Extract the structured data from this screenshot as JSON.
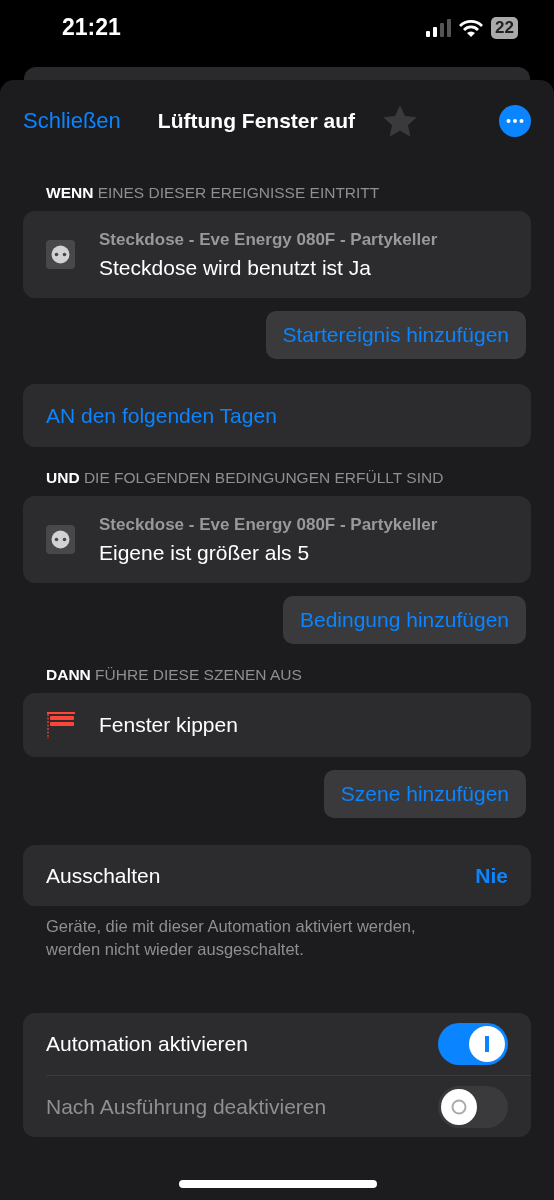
{
  "status_bar": {
    "time": "21:21",
    "battery": "22"
  },
  "header": {
    "close": "Schließen",
    "title": "Lüftung Fenster auf",
    "favorite": false
  },
  "sections": [
    {
      "heading": "**WENN** EINES DIESER EREIGNISSE EINTRITT",
      "items": [
        {
          "kind": "outlet",
          "subtitle": "Steckdose - Eve Energy 080F - Partykeller",
          "label": "Steckdose wird benutzt ist Ja"
        }
      ],
      "add_button": "Startereignis hinzufügen"
    },
    {
      "link_card": "AN den folgenden Tagen"
    },
    {
      "heading": "**UND** DIE FOLGENDEN BEDINGUNGEN ERFÜLLT SIND",
      "items": [
        {
          "kind": "outlet",
          "subtitle": "Steckdose - Eve Energy 080F - Partykeller",
          "label": "Eigene ist größer als 5"
        }
      ],
      "add_button": "Bedingung hinzufügen"
    },
    {
      "heading": "**DANN** FÜHRE DIESE SZENEN AUS",
      "items": [
        {
          "kind": "blinds",
          "label": "Fenster kippen"
        }
      ],
      "add_button": "Szene hinzufügen"
    }
  ],
  "turn_off": {
    "label": "Ausschalten",
    "value": "Nie",
    "note": "Geräte, die mit dieser Automation aktiviert werden, werden nicht wieder ausgeschaltet."
  },
  "toggles": [
    {
      "label": "Automation aktivieren",
      "on": true,
      "disabled": false
    },
    {
      "label": "Nach Ausführung deaktivieren",
      "on": false,
      "disabled": true
    }
  ]
}
